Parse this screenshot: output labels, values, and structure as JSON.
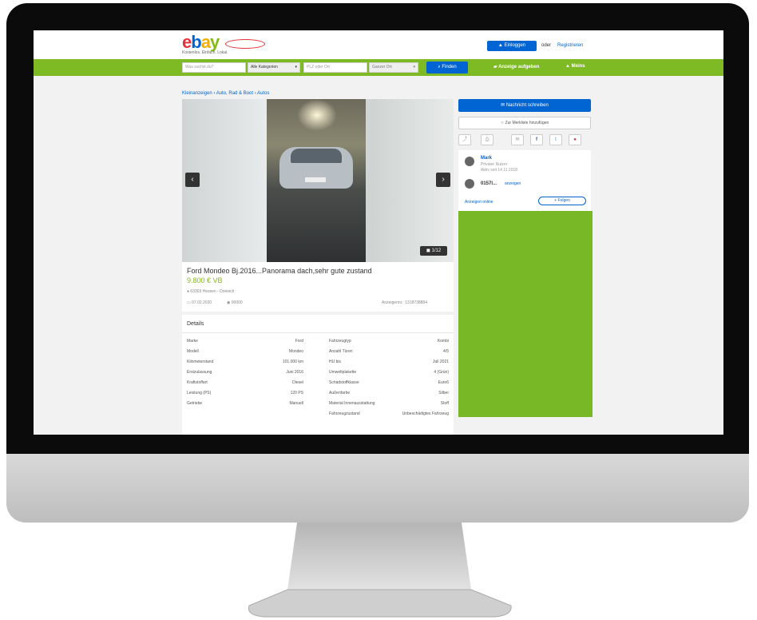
{
  "header": {
    "logo_e": "e",
    "logo_b": "b",
    "logo_a": "a",
    "logo_y": "y",
    "slogan": "Kostenlos. Einfach. Lokal.",
    "login": "Einloggen",
    "or": "oder",
    "register": "Registrieren"
  },
  "search": {
    "query_placeholder": "Was suchst du?",
    "category": "Alle Kategorien",
    "location_placeholder": "PLZ oder Ort",
    "radius": "Ganzer Ort",
    "find": "Finden",
    "post_ad": "Anzeige aufgeben",
    "my": "Meins"
  },
  "breadcrumb": "Kleinanzeigen › Auto, Rad & Boot › Autos",
  "gallery": {
    "prev": "‹",
    "next": "›",
    "counter": "1/12"
  },
  "ad": {
    "title": "Ford Mondeo Bj.2016...Panorama dach,sehr gute zustand",
    "price": "9.800 € VB",
    "location": "63303 Hessen - Dreieich",
    "date": "07.02.2020",
    "views": "00000",
    "ad_id": "Anzeigennr.: 1318738884"
  },
  "details": {
    "heading": "Details",
    "left": [
      {
        "k": "Marke",
        "v": "Ford"
      },
      {
        "k": "Modell",
        "v": "Mondeo"
      },
      {
        "k": "Kilometerstand",
        "v": "101.000 km"
      },
      {
        "k": "Erstzulassung",
        "v": "Juni 2016"
      },
      {
        "k": "Kraftstoffart",
        "v": "Diesel"
      },
      {
        "k": "Leistung (PS)",
        "v": "120 PS"
      },
      {
        "k": "Getriebe",
        "v": "Manuell"
      }
    ],
    "right": [
      {
        "k": "Fahrzeugtyp",
        "v": "Kombi"
      },
      {
        "k": "Anzahl Türen",
        "v": "4/5"
      },
      {
        "k": "HU bis",
        "v": "Juli 2021"
      },
      {
        "k": "Umweltplakette",
        "v": "4 (Grün)"
      },
      {
        "k": "Schadstoffklasse",
        "v": "Euro6"
      },
      {
        "k": "Außenfarbe",
        "v": "Silber"
      },
      {
        "k": "Material Innenausstattung",
        "v": "Stoff"
      },
      {
        "k": "Fahrzeugzustand",
        "v": "Unbeschädigtes Fahrzeug"
      }
    ]
  },
  "sidebar": {
    "message": "Nachricht schreiben",
    "watchlist": "Zur Merkliste hinzufügen",
    "seller_name": "Mark",
    "seller_type": "Privater Nutzer",
    "seller_since": "Aktiv seit 14.11.2018",
    "phone": "0157l...",
    "phone_show": "anzeigen",
    "other_ads": "Anzeigen online",
    "follow": "Folgen"
  },
  "colors": {
    "brand_green": "#7dba23",
    "brand_blue": "#0064d2"
  }
}
